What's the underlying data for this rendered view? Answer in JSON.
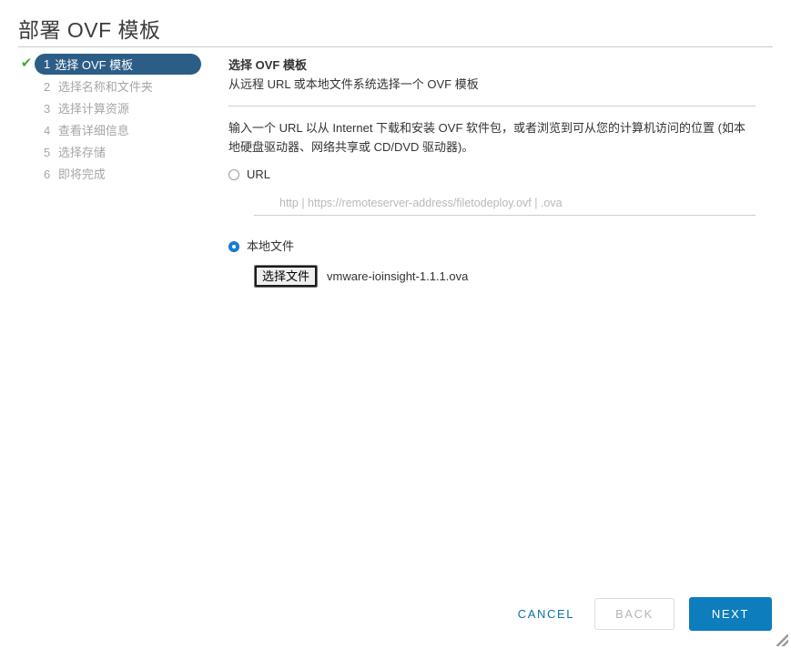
{
  "window": {
    "title": "部署 OVF 模板"
  },
  "steps": [
    {
      "number": "1",
      "label": "选择 OVF 模板",
      "state": "active",
      "completed": true
    },
    {
      "number": "2",
      "label": "选择名称和文件夹",
      "state": "pending",
      "completed": false
    },
    {
      "number": "3",
      "label": "选择计算资源",
      "state": "pending",
      "completed": false
    },
    {
      "number": "4",
      "label": "查看详细信息",
      "state": "pending",
      "completed": false
    },
    {
      "number": "5",
      "label": "选择存储",
      "state": "pending",
      "completed": false
    },
    {
      "number": "6",
      "label": "即将完成",
      "state": "pending",
      "completed": false
    }
  ],
  "content": {
    "heading": "选择 OVF 模板",
    "subheading": "从远程 URL 或本地文件系统选择一个 OVF 模板",
    "description": "输入一个 URL 以从 Internet 下载和安装 OVF 软件包，或者浏览到可从您的计算机访问的位置 (如本地硬盘驱动器、网络共享或 CD/DVD 驱动器)。",
    "url_option": {
      "label": "URL",
      "selected": false,
      "input_value": "",
      "input_placeholder": "http | https://remoteserver-address/filetodeploy.ovf | .ova"
    },
    "local_option": {
      "label": "本地文件",
      "selected": true,
      "button_label": "选择文件",
      "file_name": "vmware-ioinsight-1.1.1.ova"
    }
  },
  "footer": {
    "cancel_label": "CANCEL",
    "back_label": "BACK",
    "next_label": "NEXT"
  },
  "icons": {
    "check": "✔"
  },
  "colors": {
    "active_step_bg": "#2c5d87",
    "primary_button": "#0d7dbd",
    "link": "#0f6fa8",
    "check_green": "#4aaa33",
    "radio_selected": "#1b7fd4"
  }
}
